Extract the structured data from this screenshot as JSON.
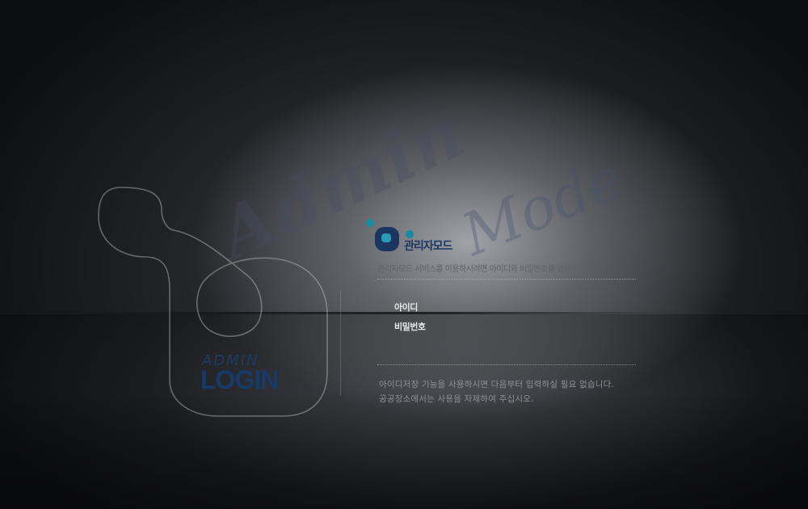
{
  "watermark": {
    "admin": "Admin",
    "mode": "Mode"
  },
  "badge": {
    "small": "ADMIN",
    "large": "LOGIN"
  },
  "logo": {
    "title": "관리자모드",
    "icon": "admin-logo-icon"
  },
  "form": {
    "subtitle": "관리자모드 서비스를 이용하시려면 아이디와 비밀번호를 입력하세요.",
    "id_label": "아이디",
    "id_value": "",
    "password_label": "비밀번호",
    "password_value": ""
  },
  "notice": {
    "line1": "아이디저장 기능을 사용하시면 다음부터 입력하실 필요 없습니다.",
    "line2": "공공장소에서는 사용을 자제하여 주십시오."
  },
  "colors": {
    "brand": "#1d3562",
    "accent": "#1a8aa3",
    "background": "#1b1d21"
  }
}
